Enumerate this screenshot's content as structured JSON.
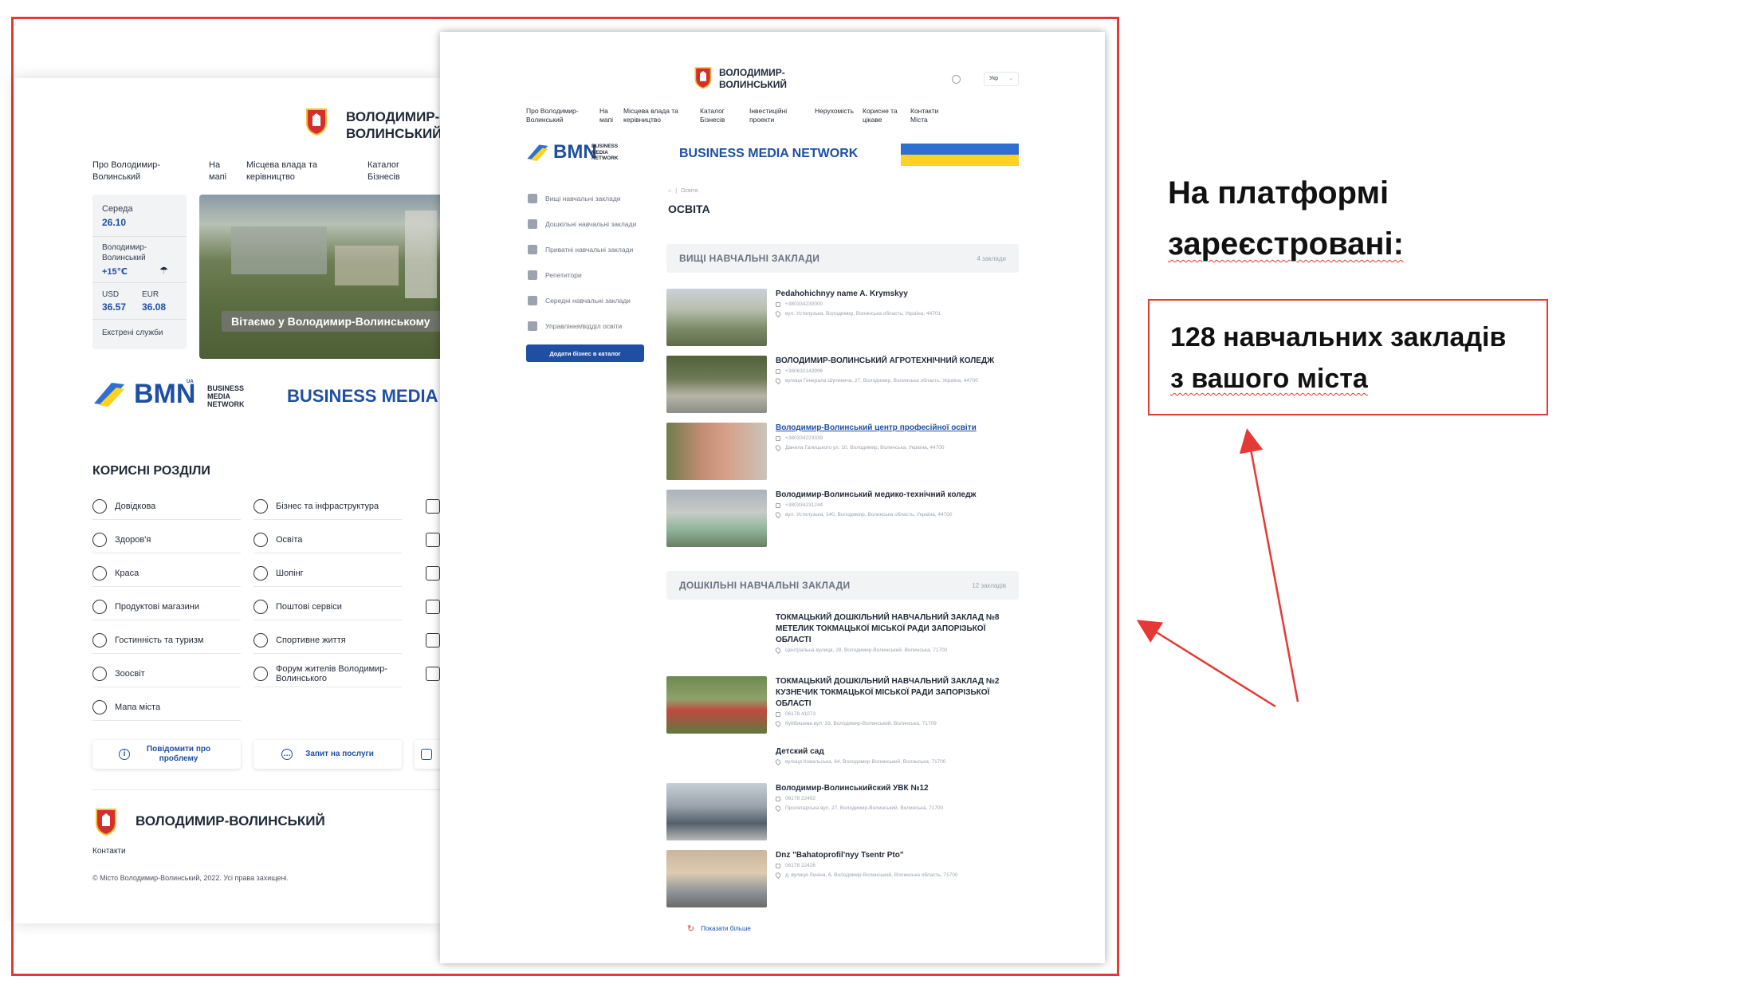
{
  "left_page": {
    "city_name": "ВОЛОДИМИР-ВОЛИНСЬКИЙ",
    "nav": [
      "Про Володимир-Волинський",
      "На мапі",
      "Місцева влада та керівництво",
      "Каталог Бізнесів"
    ],
    "day": "Середа",
    "date": "26.10",
    "weather_city": "Володимир-Волинський",
    "temperature": "+15℃",
    "usd_label": "USD",
    "usd_value": "36.57",
    "eur_label": "EUR",
    "eur_value": "36.08",
    "emergency": "Екстрені служби",
    "banner_text": "Вітаємо у Володимир-Волинському",
    "bmn_text": "BMN",
    "bmn_sub": "BUSINESS MEDIA NETWORK",
    "bmn_tag": "UA",
    "business_media": "BUSINESS MEDIA",
    "sections_title": "КОРИСНІ РОЗДІЛИ",
    "sections_col1": [
      {
        "label": "Довідкова",
        "icon": "question-icon"
      },
      {
        "label": "Здоров'я",
        "icon": "health-icon"
      },
      {
        "label": "Краса",
        "icon": "beauty-icon"
      },
      {
        "label": "Продуктові магазини",
        "icon": "cart-icon"
      },
      {
        "label": "Гостинність та туризм",
        "icon": "tourism-icon"
      },
      {
        "label": "Зоосвіт",
        "icon": "paw-icon"
      },
      {
        "label": "Мапа міста",
        "icon": "map-pin-icon"
      }
    ],
    "sections_col2": [
      {
        "label": "Бізнес та інфраструктура",
        "icon": "business-icon"
      },
      {
        "label": "Освіта",
        "icon": "graduation-icon"
      },
      {
        "label": "Шопінг",
        "icon": "shopping-icon"
      },
      {
        "label": "Поштові сервіси",
        "icon": "mail-icon"
      },
      {
        "label": "Спортивне життя",
        "icon": "dumbbell-icon"
      },
      {
        "label": "Форум жителів Володимир-Волинського",
        "icon": "forum-icon"
      }
    ],
    "report_problem": "Повідомити про проблему",
    "service_request": "Запит на послуги",
    "footer_name": "ВОЛОДИМИР-ВОЛИНСЬКИЙ",
    "footer_contacts": "Контакти",
    "copyright": "© Місто Володимир-Волинський, 2022. Усі права захищені."
  },
  "right_page": {
    "city_name_line1": "ВОЛОДИМИР-",
    "city_name_line2": "ВОЛИНСЬКИЙ",
    "lang": "Укр",
    "nav": [
      "Про Володимир-Волинський",
      "На мапі",
      "Місцева влада та керівництво",
      "Каталог Бізнесів",
      "Інвестиційні проекти",
      "Нерухомість",
      "Корисне та цікаве",
      "Контакти Міста"
    ],
    "bmn_text": "BMN",
    "bmn_sub": "BUSINESS MEDIA NETWORK",
    "business_media_network": "BUSINESS MEDIA NETWORK",
    "sidebar": [
      "Вищі навчальні заклади",
      "Дошкільні навчальні заклади",
      "Приватні навчальні заклади",
      "Репетитори",
      "Середні навчальні заклади",
      "Управління/відділ освіти"
    ],
    "add_business": "Додати бізнес в каталог",
    "breadcrumb": "Освіта",
    "page_title": "ОСВІТА",
    "higher_title": "ВИЩІ НАВЧАЛЬНІ ЗАКЛАДИ",
    "higher_count": "4 заклади",
    "higher": [
      {
        "name": "Pedahohichnyy name A. Krymskyy",
        "phone": "+380334230000",
        "address": "вул. Устилузька, Володимир, Волинська область, Україна, 44701"
      },
      {
        "name": "ВОЛОДИМИР-ВОЛИНСЬКИЙ АГРОТЕХНІЧНИЙ КОЛЕДЖ",
        "phone": "+380632143996",
        "address": "вулиця Генерала Шухевича, 27, Володимир, Волинська область, Україна, 44700"
      },
      {
        "name": "Володимир-Волинський центр професійної освіти",
        "phone": "+380334223339",
        "address": "Данила Галицького ул. 10, Володимир, Волинська, Україна, 44700"
      },
      {
        "name": "Володимир-Волинський медико-технічний коледж",
        "phone": "+380334231244",
        "address": "вул. Устилузька, 140, Володимир, Волинська область, Україна, 44700"
      }
    ],
    "preschool_title": "ДОШКІЛЬНІ НАВЧАЛЬНІ ЗАКЛАДИ",
    "preschool_count": "12 закладів",
    "preschool": [
      {
        "name": "ТОКМАЦЬКИЙ ДОШКІЛЬНИЙ НАВЧАЛЬНИЙ ЗАКЛАД №8 МЕТЕЛИК ТОКМАЦЬКОЇ МІСЬКОЇ РАДИ ЗАПОРІЗЬКОЇ ОБЛАСТІ",
        "phone": "",
        "address": "Центральна вулиця, 28, Володимир-Волинський, Волинська, 71700"
      },
      {
        "name": "ТОКМАЦЬКИЙ ДОШКІЛЬНИЙ НАВЧАЛЬНИЙ ЗАКЛАД №2 КУЗНЕЧИК ТОКМАЦЬКОЇ МІСЬКОЇ РАДИ ЗАПОРІЗЬКОЇ ОБЛАСТІ",
        "phone": "06178 41073",
        "address": "Куйбишева вул. 33, Володимир-Волинський, Волинська, 71709"
      },
      {
        "name": "Детский сад",
        "phone": "",
        "address": "вулиця Ковальська, 64, Володимир-Волинський, Волинська, 71700"
      },
      {
        "name": "Володимир-Волинськийский УВК №12",
        "phone": "06178 22492",
        "address": "Пролетарська вул. 27, Володимир-Волинський, Волинська, 71700"
      },
      {
        "name": "Dnz \"Bahatoprofil'nyy Tsentr Pto\"",
        "phone": "06178 22426",
        "address": "д. вулиця Леніна, 6, Володимир-Волинський, Волинська область, 71700"
      }
    ],
    "show_more": "Показати більше"
  },
  "annotation": {
    "heading_line1": "На платформі",
    "heading_line2": "зареєстровані:",
    "callout_line1": "128 навчальних закладів",
    "callout_line2": "з вашого міста"
  },
  "colors": {
    "frame": "#e53935",
    "brand_blue": "#1e4fa3",
    "flag_blue": "#2f6fd1",
    "flag_yellow": "#ffd21f"
  }
}
